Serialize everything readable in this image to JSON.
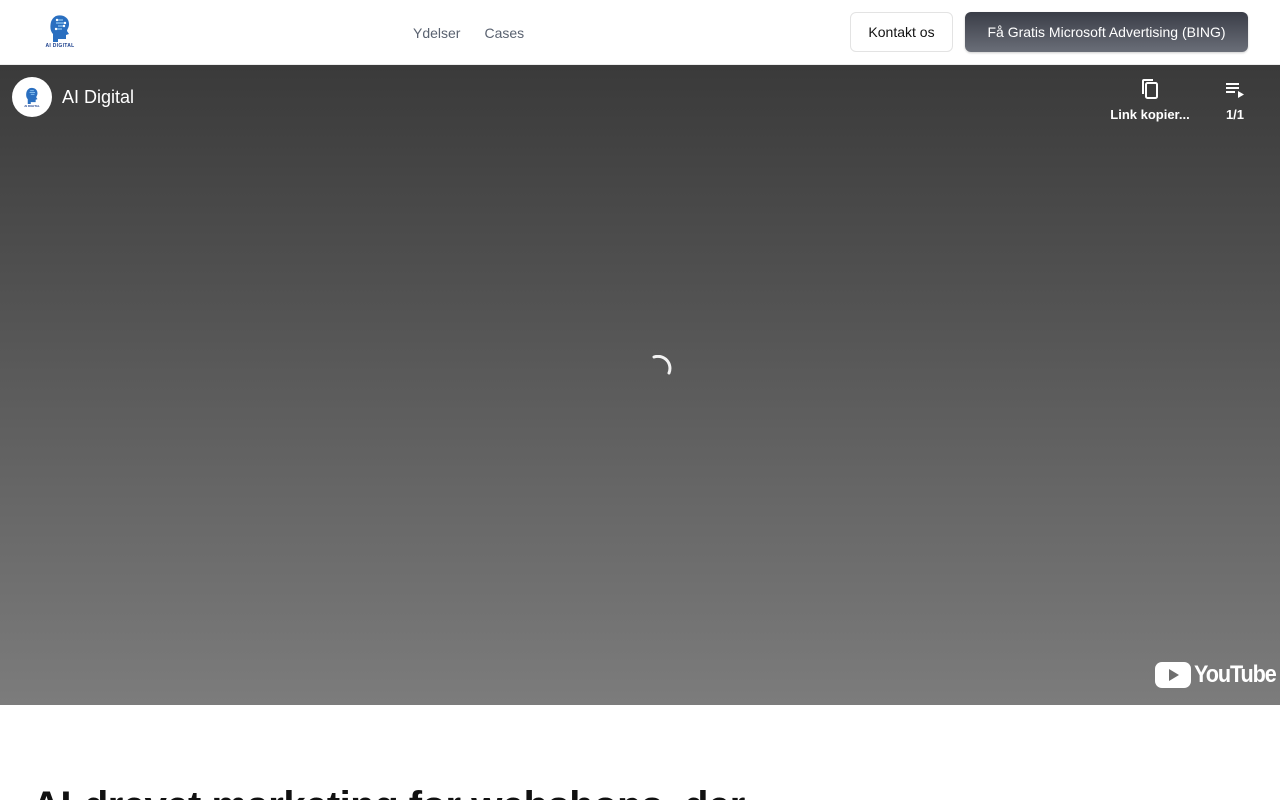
{
  "header": {
    "logo_text": "AI DIGITAL",
    "nav": [
      {
        "label": "Ydelser"
      },
      {
        "label": "Cases"
      }
    ],
    "contact_label": "Kontakt os",
    "cta_label": "Få Gratis Microsoft Advertising (BING)"
  },
  "video": {
    "channel_name": "AI Digital",
    "avatar_text": "AI DIGITAL",
    "copy_link_label": "Link kopier...",
    "playlist_label": "1/1",
    "brand_word": "YouTube",
    "icons": {
      "copy": "copy-link-icon",
      "playlist": "playlist-icon",
      "spinner": "loading-spinner-icon",
      "brand": "youtube-logo-icon"
    }
  },
  "main": {
    "hero_title": "AI-drevet marketing for webshops, der"
  },
  "colors": {
    "cta_top": "#3a3d47",
    "cta_bottom": "#6a6e78",
    "logo_blue": "#1b3f8c",
    "youtube_red": "#ffffff"
  }
}
